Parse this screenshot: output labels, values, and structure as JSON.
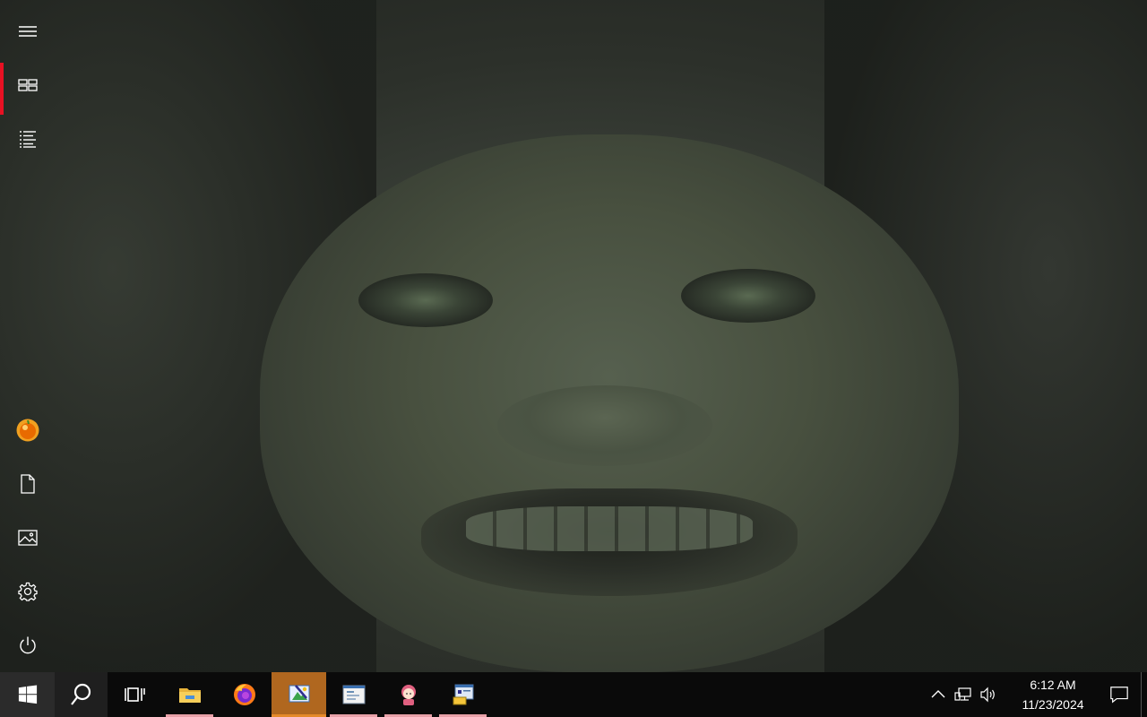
{
  "rail": {
    "items": [
      {
        "name": "hamburger-menu",
        "icon": "hamburger-icon"
      },
      {
        "name": "tiles-view",
        "icon": "tiles-icon",
        "active": true
      },
      {
        "name": "all-apps-list",
        "icon": "list-icon"
      },
      {
        "name": "user-account",
        "icon": "orange-avatar-icon"
      },
      {
        "name": "documents",
        "icon": "document-icon"
      },
      {
        "name": "pictures",
        "icon": "picture-icon"
      },
      {
        "name": "settings",
        "icon": "gear-icon"
      },
      {
        "name": "power",
        "icon": "power-icon"
      }
    ]
  },
  "taskbar": {
    "pinned": [
      {
        "name": "file-explorer",
        "icon": "folder-icon",
        "running": true
      },
      {
        "name": "firefox",
        "icon": "firefox-icon",
        "running": false
      },
      {
        "name": "paint-app",
        "icon": "paint-icon",
        "running": true,
        "active": true
      },
      {
        "name": "window-app",
        "icon": "window-icon",
        "running": true
      },
      {
        "name": "anime-app",
        "icon": "character-icon",
        "running": true
      },
      {
        "name": "settings-app",
        "icon": "control-panel-icon",
        "running": true
      }
    ],
    "colors": {
      "accent": "#b0671f",
      "running_indicator": "#e8a0a8",
      "active_rail": "#e81123"
    }
  },
  "tray": {
    "time": "6:12 AM",
    "date": "11/23/2024"
  }
}
